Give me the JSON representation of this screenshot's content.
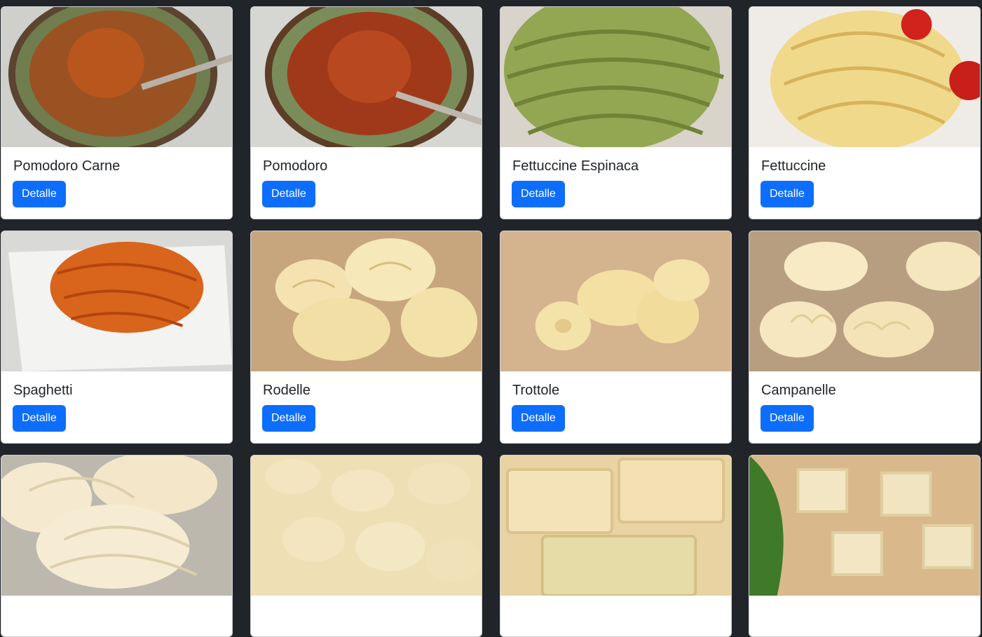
{
  "button_label": "Detalle",
  "colors": {
    "page_bg": "#212529",
    "card_bg": "#ffffff",
    "button_bg": "#0d6efd",
    "button_text": "#ffffff"
  },
  "products": [
    {
      "title": "Pomodoro Carne",
      "image": "sauce-bowl-meat"
    },
    {
      "title": "Pomodoro",
      "image": "sauce-bowl-tomato"
    },
    {
      "title": "Fettuccine Espinaca",
      "image": "green-fettuccine-nests"
    },
    {
      "title": "Fettuccine",
      "image": "yellow-fettuccine-nests"
    },
    {
      "title": "Spaghetti",
      "image": "orange-pasta-ribbons-on-plate"
    },
    {
      "title": "Rodelle",
      "image": "spiral-pasta"
    },
    {
      "title": "Trottole",
      "image": "trottole-pasta"
    },
    {
      "title": "Campanelle",
      "image": "campanelle-pasta"
    },
    {
      "title": "",
      "image": "twisted-fresh-pasta"
    },
    {
      "title": "",
      "image": "gnocchi"
    },
    {
      "title": "",
      "image": "ravioli-close-up"
    },
    {
      "title": "",
      "image": "ravioli-with-spinach-leaf"
    }
  ]
}
